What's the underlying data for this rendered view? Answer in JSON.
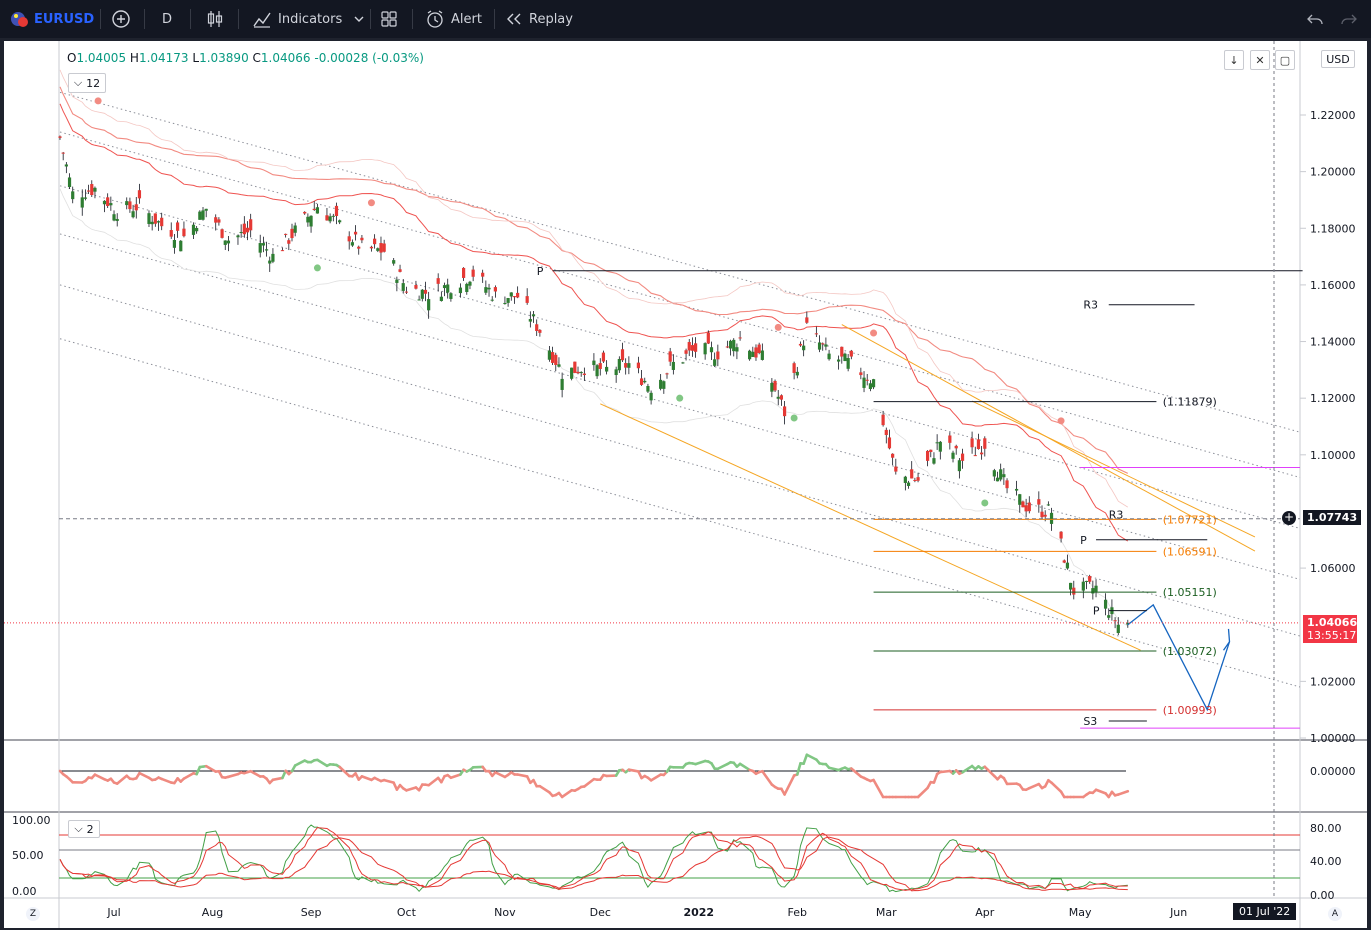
{
  "toolbar": {
    "symbol": "EURUSD",
    "interval": "D",
    "indicators_label": "Indicators",
    "alert_label": "Alert",
    "replay_label": "Replay",
    "icons": [
      "flag-icon",
      "plus-circle-icon",
      "candles-icon",
      "chart-icon",
      "chevron-down-icon",
      "layout-icon",
      "alarm-icon",
      "rewind-icon",
      "undo-icon",
      "redo-icon"
    ]
  },
  "legend": {
    "open_label": "O",
    "open": "1.04005",
    "high_label": "H",
    "high": "1.04173",
    "low_label": "L",
    "low": "1.03890",
    "close_label": "C",
    "close": "1.04066",
    "change": "-0.00028 (-0.03%)",
    "indicator_count": "12",
    "pane3_count": "2"
  },
  "currency": "USD",
  "controls": [
    "down-arrow-icon",
    "collapse-icon",
    "maximize-icon"
  ],
  "colors": {
    "up": "#089981",
    "down": "#f23645",
    "up_candle": "#26a69a",
    "down_candle": "#ef5350",
    "accent": "#2962ff"
  },
  "price_tags": {
    "crosshair": "1.07743",
    "last_price": "1.04066",
    "countdown": "13:55:17"
  },
  "time_marker": "01 Jul '22",
  "scale_buttons": {
    "left": "Z",
    "right": "A"
  },
  "chart_data": {
    "type": "candlestick",
    "symbol": "EURUSD",
    "interval": "D",
    "x_ticks": [
      "Jul",
      "Aug",
      "Sep",
      "Oct",
      "Nov",
      "Dec",
      "2022",
      "Feb",
      "Mar",
      "Apr",
      "May",
      "Jun"
    ],
    "y_ticks": [
      "1.22000",
      "1.20000",
      "1.18000",
      "1.16000",
      "1.14000",
      "1.12000",
      "1.10000",
      "1.06000",
      "1.02000",
      "1.00000"
    ],
    "ylim": [
      1.0,
      1.228
    ],
    "close_path": [
      [
        "2021-06-14",
        1.212
      ],
      [
        "2021-06-18",
        1.192
      ],
      [
        "2021-06-25",
        1.194
      ],
      [
        "2021-07-02",
        1.186
      ],
      [
        "2021-07-09",
        1.188
      ],
      [
        "2021-07-16",
        1.181
      ],
      [
        "2021-07-23",
        1.177
      ],
      [
        "2021-07-30",
        1.187
      ],
      [
        "2021-08-06",
        1.176
      ],
      [
        "2021-08-13",
        1.179
      ],
      [
        "2021-08-20",
        1.17
      ],
      [
        "2021-08-27",
        1.179
      ],
      [
        "2021-09-03",
        1.188
      ],
      [
        "2021-09-10",
        1.181
      ],
      [
        "2021-09-17",
        1.173
      ],
      [
        "2021-09-24",
        1.172
      ],
      [
        "2021-10-01",
        1.159
      ],
      [
        "2021-10-08",
        1.157
      ],
      [
        "2021-10-15",
        1.16
      ],
      [
        "2021-10-22",
        1.164
      ],
      [
        "2021-10-29",
        1.156
      ],
      [
        "2021-11-05",
        1.156
      ],
      [
        "2021-11-12",
        1.144
      ],
      [
        "2021-11-19",
        1.129
      ],
      [
        "2021-11-26",
        1.131
      ],
      [
        "2021-12-03",
        1.13
      ],
      [
        "2021-12-10",
        1.132
      ],
      [
        "2021-12-17",
        1.124
      ],
      [
        "2021-12-24",
        1.132
      ],
      [
        "2021-12-31",
        1.137
      ],
      [
        "2022-01-07",
        1.136
      ],
      [
        "2022-01-14",
        1.141
      ],
      [
        "2022-01-21",
        1.134
      ],
      [
        "2022-01-28",
        1.115
      ],
      [
        "2022-02-04",
        1.145
      ],
      [
        "2022-02-11",
        1.135
      ],
      [
        "2022-02-18",
        1.132
      ],
      [
        "2022-02-25",
        1.126
      ],
      [
        "2022-03-04",
        1.093
      ],
      [
        "2022-03-11",
        1.091
      ],
      [
        "2022-03-18",
        1.105
      ],
      [
        "2022-03-25",
        1.098
      ],
      [
        "2022-04-01",
        1.104
      ],
      [
        "2022-04-08",
        1.088
      ],
      [
        "2022-04-15",
        1.081
      ],
      [
        "2022-04-22",
        1.08
      ],
      [
        "2022-04-29",
        1.052
      ],
      [
        "2022-05-06",
        1.053
      ],
      [
        "2022-05-13",
        1.04
      ],
      [
        "2022-05-16",
        1.04066
      ]
    ],
    "levels": [
      {
        "label": "P",
        "price": 1.165,
        "color": "#131722"
      },
      {
        "label": "R3",
        "price": 1.153,
        "color": "#131722"
      },
      {
        "label": "(1.11879)",
        "price": 1.11879,
        "color": "#131722"
      },
      {
        "label": "R3",
        "price": 1.0772,
        "color": "#131722"
      },
      {
        "label": "(1.07721)",
        "price": 1.07721,
        "color": "#f57c00"
      },
      {
        "label": "P",
        "price": 1.07,
        "color": "#131722"
      },
      {
        "label": "(1.06591)",
        "price": 1.06591,
        "color": "#f57c00"
      },
      {
        "label": "(1.05151)",
        "price": 1.05151,
        "color": "#1b5e20"
      },
      {
        "label": "P",
        "price": 1.045,
        "color": "#131722"
      },
      {
        "label": "(1.03072)",
        "price": 1.03072,
        "color": "#1b5e20"
      },
      {
        "label": "(1.00993)",
        "price": 1.00993,
        "color": "#d32f2f"
      },
      {
        "label": "S3",
        "price": 1.006,
        "color": "#131722"
      }
    ],
    "pane2": {
      "y_ticks": [
        "0.00000"
      ]
    },
    "pane3": {
      "y_ticks_left": [
        "100.00",
        "50.00",
        "0.00"
      ],
      "y_ticks_right": [
        "80.00",
        "40.00",
        "0.00"
      ]
    }
  }
}
